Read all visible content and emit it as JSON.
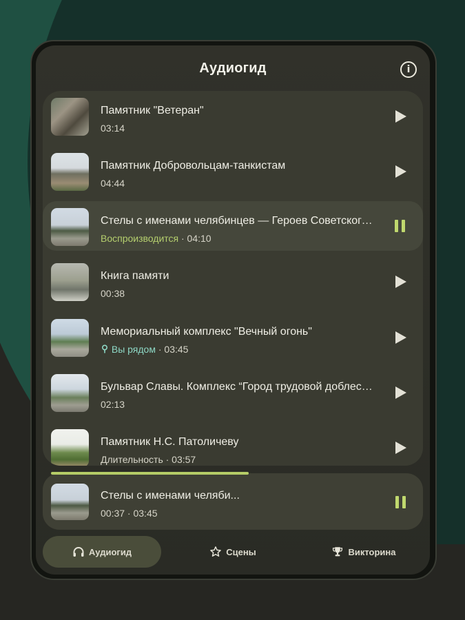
{
  "app": {
    "title": "Аудиогид"
  },
  "colors": {
    "accent": "#b5cf6e",
    "near": "#8ed8c6",
    "panel": "#3a3b31"
  },
  "tracks": [
    {
      "title": "Памятник \"Ветеран\"",
      "meta": "03:14"
    },
    {
      "title": "Памятник Добровольцам-танкистам",
      "meta": "04:44"
    },
    {
      "title": "Стелы с именами челябинцев — Героев Советского Союза",
      "status": "Воспроизводится",
      "meta": " · 04:10"
    },
    {
      "title": "Книга памяти",
      "meta": "00:38"
    },
    {
      "title": "Мемориальный комплекс \"Вечный огонь\"",
      "status": "Вы рядом",
      "meta": " · 03:45"
    },
    {
      "title": "Бульвар Славы. Комплекс “Город трудовой доблести”",
      "meta": "02:13"
    },
    {
      "title": "Памятник Н.С. Патоличеву",
      "meta": "Длительность · 03:57"
    }
  ],
  "player": {
    "title": "Стелы с именами челяби...",
    "time": "00:37 · 03:45",
    "progress": 0.52
  },
  "nav": {
    "tabs": [
      {
        "label": "Аудиогид",
        "icon": "headphones-icon",
        "active": true
      },
      {
        "label": "Сцены",
        "icon": "star-icon",
        "active": false
      },
      {
        "label": "Викторина",
        "icon": "trophy-icon",
        "active": false
      }
    ]
  }
}
